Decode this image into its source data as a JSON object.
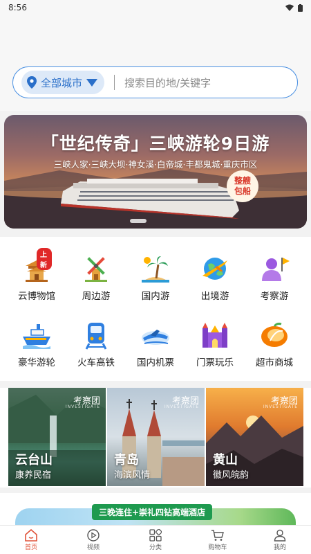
{
  "status": {
    "time": "8:56"
  },
  "search": {
    "city_label": "全部城市",
    "placeholder": "搜索目的地/关键字"
  },
  "banner": {
    "title": "「世纪传奇」三峡游轮9日游",
    "subtitle": "三峡人家·三峡大坝·神女溪·白帝城·丰都鬼城·重庆市区",
    "badge_line1": "整艘",
    "badge_line2": "包船"
  },
  "categories": [
    {
      "label": "云博物馆",
      "icon": "pavilion-icon",
      "tag": "上新"
    },
    {
      "label": "周边游",
      "icon": "windmill-icon"
    },
    {
      "label": "国内游",
      "icon": "palm-tree-icon"
    },
    {
      "label": "出境游",
      "icon": "plane-globe-icon"
    },
    {
      "label": "考察游",
      "icon": "person-flag-icon"
    },
    {
      "label": "豪华游轮",
      "icon": "cruise-ship-icon"
    },
    {
      "label": "火车高铁",
      "icon": "train-icon"
    },
    {
      "label": "国内机票",
      "icon": "airplane-icon"
    },
    {
      "label": "门票玩乐",
      "icon": "castle-icon"
    },
    {
      "label": "超市商城",
      "icon": "fruit-icon"
    }
  ],
  "destinations": [
    {
      "name": "云台山",
      "desc": "康养民宿",
      "watermark": "考察团",
      "watermark_sub": "INVESTIGATE"
    },
    {
      "name": "青岛",
      "desc": "海滨风情",
      "watermark": "考察团",
      "watermark_sub": "INVESTIGATE"
    },
    {
      "name": "黄山",
      "desc": "徽风皖韵",
      "watermark": "考察团",
      "watermark_sub": "INVESTIGATE"
    }
  ],
  "promo": {
    "tag": "三晚连住+崇礼四钻高端酒店"
  },
  "tabs": [
    {
      "label": "首页",
      "icon": "home-icon"
    },
    {
      "label": "视频",
      "icon": "play-icon"
    },
    {
      "label": "分类",
      "icon": "grid-icon"
    },
    {
      "label": "购物车",
      "icon": "cart-icon"
    },
    {
      "label": "我的",
      "icon": "user-icon"
    }
  ],
  "colors": {
    "accent": "#e0533a",
    "search_border": "#4a90e2",
    "city_text": "#2a6fc9"
  }
}
